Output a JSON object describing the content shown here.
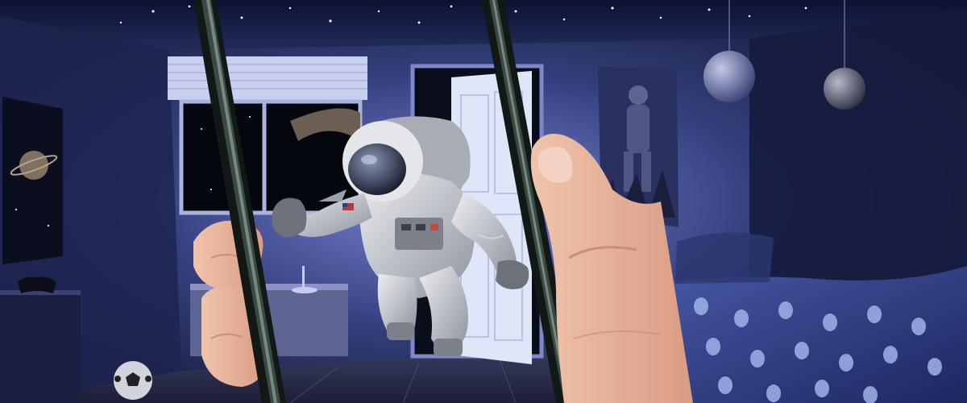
{
  "scene": {
    "palette": {
      "room_shadow": "#0c1024",
      "room_wall": "#26305e",
      "room_light": "#6f78c8",
      "floor": "#2f3350",
      "door_white": "#dfe6f7",
      "window_space": "#05070f",
      "bed_blue": "#2c3d86",
      "alien_print": "#9fb3e8",
      "skin": "#e8b49c",
      "skin_shadow": "#c98e76",
      "phone_frame": "#1c2420",
      "suit_white": "#d5d7db",
      "suit_shadow": "#8b8f99"
    },
    "icons": {
      "stars": "star-icon",
      "planets": "planet-icon",
      "alien_print": "alien-icon",
      "soccer_ball": "soccer-ball-icon",
      "game_controller": "game-controller-icon"
    }
  }
}
